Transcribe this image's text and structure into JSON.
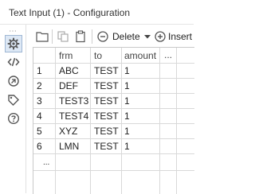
{
  "window": {
    "title": "Text Input (1) - Configuration"
  },
  "rail": {
    "overflow_glyph": "⋯",
    "icons": [
      "gear-icon",
      "code-icon",
      "switch-icon",
      "tag-icon",
      "help-icon"
    ]
  },
  "toolbar": {
    "delete_label": "Delete",
    "insert_label": "Insert",
    "icons": [
      "folder-icon",
      "copy-icon",
      "paste-icon",
      "minus-circle-icon",
      "chevron-down-icon",
      "plus-circle-icon"
    ]
  },
  "table": {
    "columns": [
      "frm",
      "to",
      "amount",
      "..."
    ],
    "rows": [
      {
        "num": "1",
        "frm": "ABC",
        "to": "TEST",
        "amount": "1"
      },
      {
        "num": "2",
        "frm": "DEF",
        "to": "TEST",
        "amount": "1"
      },
      {
        "num": "3",
        "frm": "TEST3",
        "to": "TEST",
        "amount": "1"
      },
      {
        "num": "4",
        "frm": "TEST4",
        "to": "TEST",
        "amount": "1"
      },
      {
        "num": "5",
        "frm": "XYZ",
        "to": "TEST",
        "amount": "1"
      },
      {
        "num": "6",
        "frm": "LMN",
        "to": "TEST",
        "amount": "1"
      }
    ],
    "add_row_label": "..."
  },
  "colors": {
    "active_icon_bg": "#dde8f5",
    "active_icon_border": "#9fb7d4",
    "icon": "#555555"
  }
}
